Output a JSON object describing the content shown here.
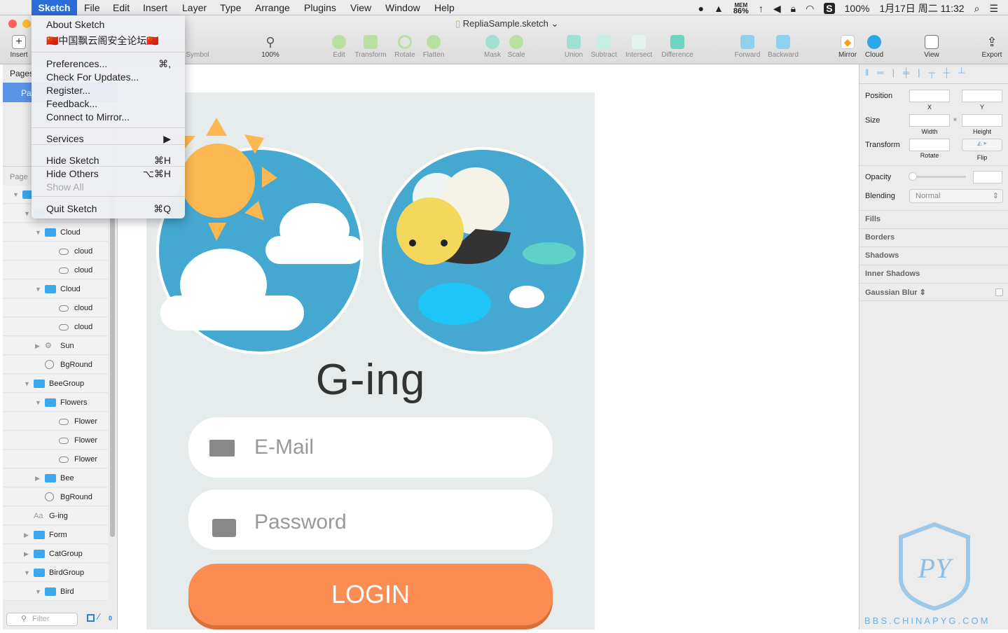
{
  "menubar": {
    "app": "Sketch",
    "items": [
      "File",
      "Edit",
      "Insert",
      "Layer",
      "Type",
      "Arrange",
      "Plugins",
      "View",
      "Window",
      "Help"
    ],
    "status": {
      "mem_label": "MEM",
      "mem_value": "86%",
      "battery": "100%",
      "datetime": "1月17日 周二 11:32"
    }
  },
  "window": {
    "title": "RepliaSample.sketch"
  },
  "toolbar": {
    "insert": "Insert",
    "symbol": "Symbol",
    "zoom": "100%",
    "edit": "Edit",
    "transform": "Transform",
    "rotate": "Rotate",
    "flatten": "Flatten",
    "mask": "Mask",
    "scale": "Scale",
    "union": "Union",
    "subtract": "Subtract",
    "intersect": "Intersect",
    "difference": "Difference",
    "forward": "Forward",
    "backward": "Backward",
    "mirror": "Mirror",
    "cloud": "Cloud",
    "view": "View",
    "export": "Export"
  },
  "app_menu": {
    "items": [
      {
        "label": "About Sketch",
        "shortcut": ""
      },
      {
        "label": "🇨🇳中国飘云阁安全论坛🇨🇳",
        "shortcut": ""
      },
      {
        "label": "Preferences...",
        "shortcut": "⌘,"
      },
      {
        "label": "Check For Updates...",
        "shortcut": ""
      },
      {
        "label": "Register...",
        "shortcut": ""
      },
      {
        "label": "Feedback...",
        "shortcut": ""
      },
      {
        "label": "Connect to Mirror...",
        "shortcut": ""
      },
      {
        "label": "Services",
        "shortcut": "▶"
      },
      {
        "label": "Hide Sketch",
        "shortcut": "⌘H"
      },
      {
        "label": "Hide Others",
        "shortcut": "⌥⌘H"
      },
      {
        "label": "Show All",
        "shortcut": "",
        "disabled": true
      },
      {
        "label": "Quit Sketch",
        "shortcut": "⌘Q"
      }
    ]
  },
  "left_panel": {
    "pages_label": "Pages",
    "selected_page": "Pa",
    "page_header": "Page",
    "filter_placeholder": "Filter",
    "edit_count": "0",
    "layers": [
      {
        "name": "",
        "type": "folder",
        "level": 0,
        "expanded": true
      },
      {
        "name": "",
        "type": "folder",
        "level": 1,
        "expanded": true
      },
      {
        "name": "Cloud",
        "type": "folder",
        "level": 2,
        "expanded": true
      },
      {
        "name": "cloud",
        "type": "shape",
        "level": 3
      },
      {
        "name": "cloud",
        "type": "shape",
        "level": 3
      },
      {
        "name": "Cloud",
        "type": "folder",
        "level": 2,
        "expanded": true
      },
      {
        "name": "cloud",
        "type": "shape",
        "level": 3
      },
      {
        "name": "cloud",
        "type": "shape",
        "level": 3
      },
      {
        "name": "Sun",
        "type": "symbol",
        "level": 2,
        "expanded": false
      },
      {
        "name": "BgRound",
        "type": "oval",
        "level": 2
      },
      {
        "name": "BeeGroup",
        "type": "folder",
        "level": 1,
        "expanded": true
      },
      {
        "name": "Flowers",
        "type": "folder",
        "level": 2,
        "expanded": true
      },
      {
        "name": "Flower",
        "type": "shape",
        "level": 3
      },
      {
        "name": "Flower",
        "type": "shape",
        "level": 3
      },
      {
        "name": "Flower",
        "type": "shape",
        "level": 3
      },
      {
        "name": "Bee",
        "type": "folder",
        "level": 2,
        "expanded": false
      },
      {
        "name": "BgRound",
        "type": "oval",
        "level": 2
      },
      {
        "name": "G-ing",
        "type": "text",
        "level": 1
      },
      {
        "name": "Form",
        "type": "folder",
        "level": 1,
        "expanded": false
      },
      {
        "name": "CatGroup",
        "type": "folder",
        "level": 1,
        "expanded": false
      },
      {
        "name": "BirdGroup",
        "type": "folder",
        "level": 1,
        "expanded": true
      },
      {
        "name": "Bird",
        "type": "folder",
        "level": 2,
        "expanded": true
      }
    ]
  },
  "artboard": {
    "title": "G-ing",
    "email_placeholder": "E-Mail",
    "password_placeholder": "Password",
    "login_label": "LOGIN",
    "login_color": "#fb8c52"
  },
  "inspector": {
    "position": "Position",
    "x": "X",
    "y": "Y",
    "size": "Size",
    "width": "Width",
    "height": "Height",
    "transform": "Transform",
    "rotate": "Rotate",
    "flip": "Flip",
    "opacity": "Opacity",
    "blending": "Blending",
    "blending_value": "Normal",
    "opacity_value": 0,
    "sections": [
      "Fills",
      "Borders",
      "Shadows",
      "Inner Shadows",
      "Gaussian Blur"
    ]
  },
  "watermark": {
    "text": "BBS.CHINAPYG.COM",
    "logo": "PY"
  }
}
